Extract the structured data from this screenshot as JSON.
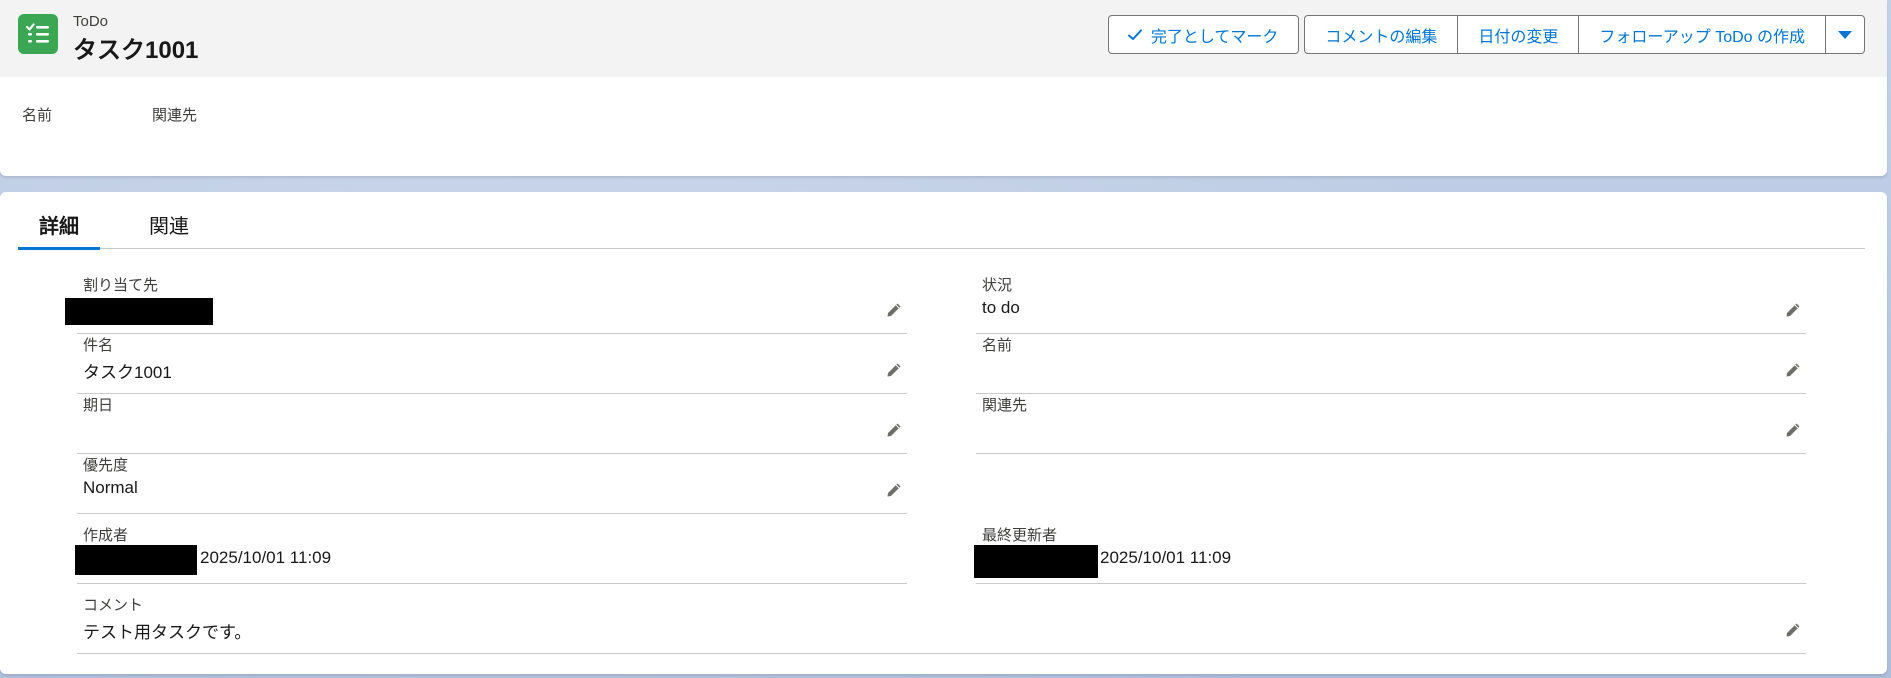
{
  "header": {
    "record_type": "ToDo",
    "record_title": "タスク1001",
    "record_icon": "task-list-icon",
    "icon_color": "#3ba755"
  },
  "actions": {
    "mark_complete": "完了としてマーク",
    "edit_comment": "コメントの編集",
    "change_date": "日付の変更",
    "create_followup": "フォローアップ ToDo の作成",
    "more_icon": "chevron-down-icon",
    "accent": "#0176d3"
  },
  "highlights": {
    "fields": [
      "名前",
      "関連先"
    ]
  },
  "tabs": [
    {
      "label": "詳細",
      "active": true
    },
    {
      "label": "関連",
      "active": false
    }
  ],
  "details": {
    "assigned_to": {
      "label": "割り当て先",
      "value": ""
    },
    "status": {
      "label": "状況",
      "value": "to do"
    },
    "subject": {
      "label": "件名",
      "value": "タスク1001"
    },
    "name": {
      "label": "名前",
      "value": ""
    },
    "due_date": {
      "label": "期日",
      "value": ""
    },
    "related_to": {
      "label": "関連先",
      "value": ""
    },
    "priority": {
      "label": "優先度",
      "value": "Normal"
    },
    "created_by": {
      "label": "作成者",
      "date": "2025/10/01 11:09"
    },
    "last_modified_by": {
      "label": "最終更新者",
      "date": "2025/10/01 11:09"
    },
    "comment": {
      "label": "コメント",
      "value": "テスト用タスクです。"
    }
  }
}
